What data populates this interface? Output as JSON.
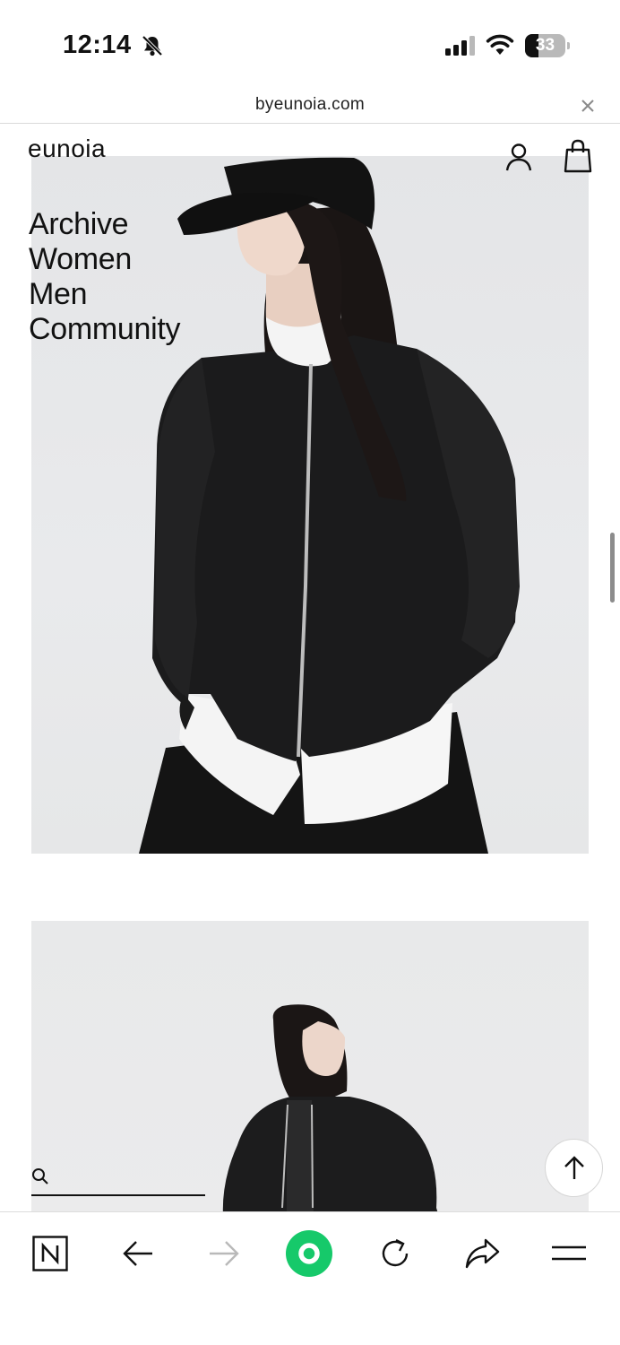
{
  "status_bar": {
    "time": "12:14",
    "battery_level": "33",
    "battery_fraction": 0.33
  },
  "browser": {
    "url": "byeunoia.com"
  },
  "site": {
    "logo": "eunoia",
    "nav": [
      "Archive",
      "Women",
      "Men",
      "Community"
    ]
  },
  "icons": {
    "silent": "bell-slash-icon",
    "signal": "cellular-signal-icon",
    "wifi": "wifi-icon",
    "close": "close-icon",
    "account": "user-icon",
    "bag": "shopping-bag-icon",
    "search": "search-icon",
    "scroll_top": "arrow-up-icon",
    "toolbar": [
      "naver-n-icon",
      "back-arrow-icon",
      "forward-arrow-icon",
      "green-circle-icon",
      "reload-icon",
      "share-icon",
      "menu-icon"
    ]
  },
  "colors": {
    "accent_green": "#16c96a",
    "text": "#111111",
    "disabled": "#b9b9b9"
  }
}
